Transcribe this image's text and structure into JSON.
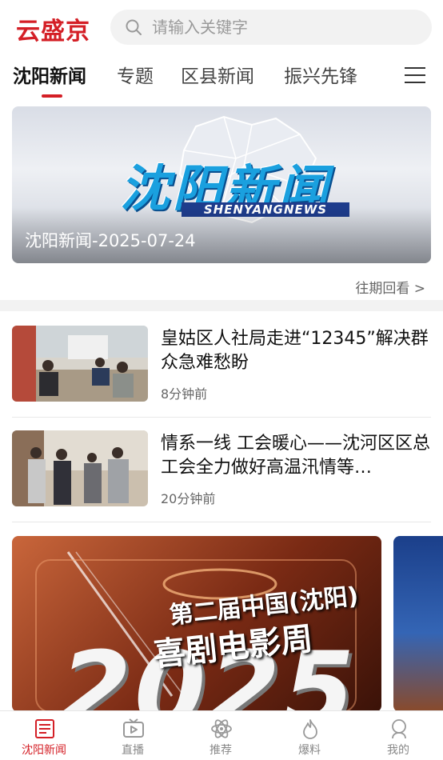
{
  "header": {
    "logo": "云盛京",
    "search_placeholder": "请输入关键字"
  },
  "tabs": [
    {
      "label": "沈阳新闻",
      "active": true
    },
    {
      "label": "专题",
      "active": false
    },
    {
      "label": "区县新闻",
      "active": false
    },
    {
      "label": "振兴先锋",
      "active": false
    }
  ],
  "banner": {
    "logo_text": "沈阳新闻",
    "logo_subtext": "SHENYANGNEWS",
    "caption": "沈阳新闻-2025-07-24"
  },
  "more_link": "往期回看 >",
  "news": [
    {
      "title": "皇姑区人社局走进“12345”解决群众急难愁盼",
      "time": "8分钟前"
    },
    {
      "title": "情系一线 工会暖心——沈河区区总工会全力做好高温汛情等…",
      "time": "20分钟前"
    }
  ],
  "carousel": {
    "card_title": "第二届中国(沈阳)",
    "card_subtitle": "喜剧电影周",
    "card_year": "2025"
  },
  "bottom_nav": [
    {
      "label": "沈阳新闻",
      "icon": "newspaper-icon",
      "active": true
    },
    {
      "label": "直播",
      "icon": "tv-play-icon",
      "active": false
    },
    {
      "label": "推荐",
      "icon": "atom-icon",
      "active": false
    },
    {
      "label": "爆料",
      "icon": "flame-icon",
      "active": false
    },
    {
      "label": "我的",
      "icon": "user-icon",
      "active": false
    }
  ],
  "colors": {
    "brand": "#d41f26",
    "text": "#222222",
    "muted": "#888888"
  }
}
